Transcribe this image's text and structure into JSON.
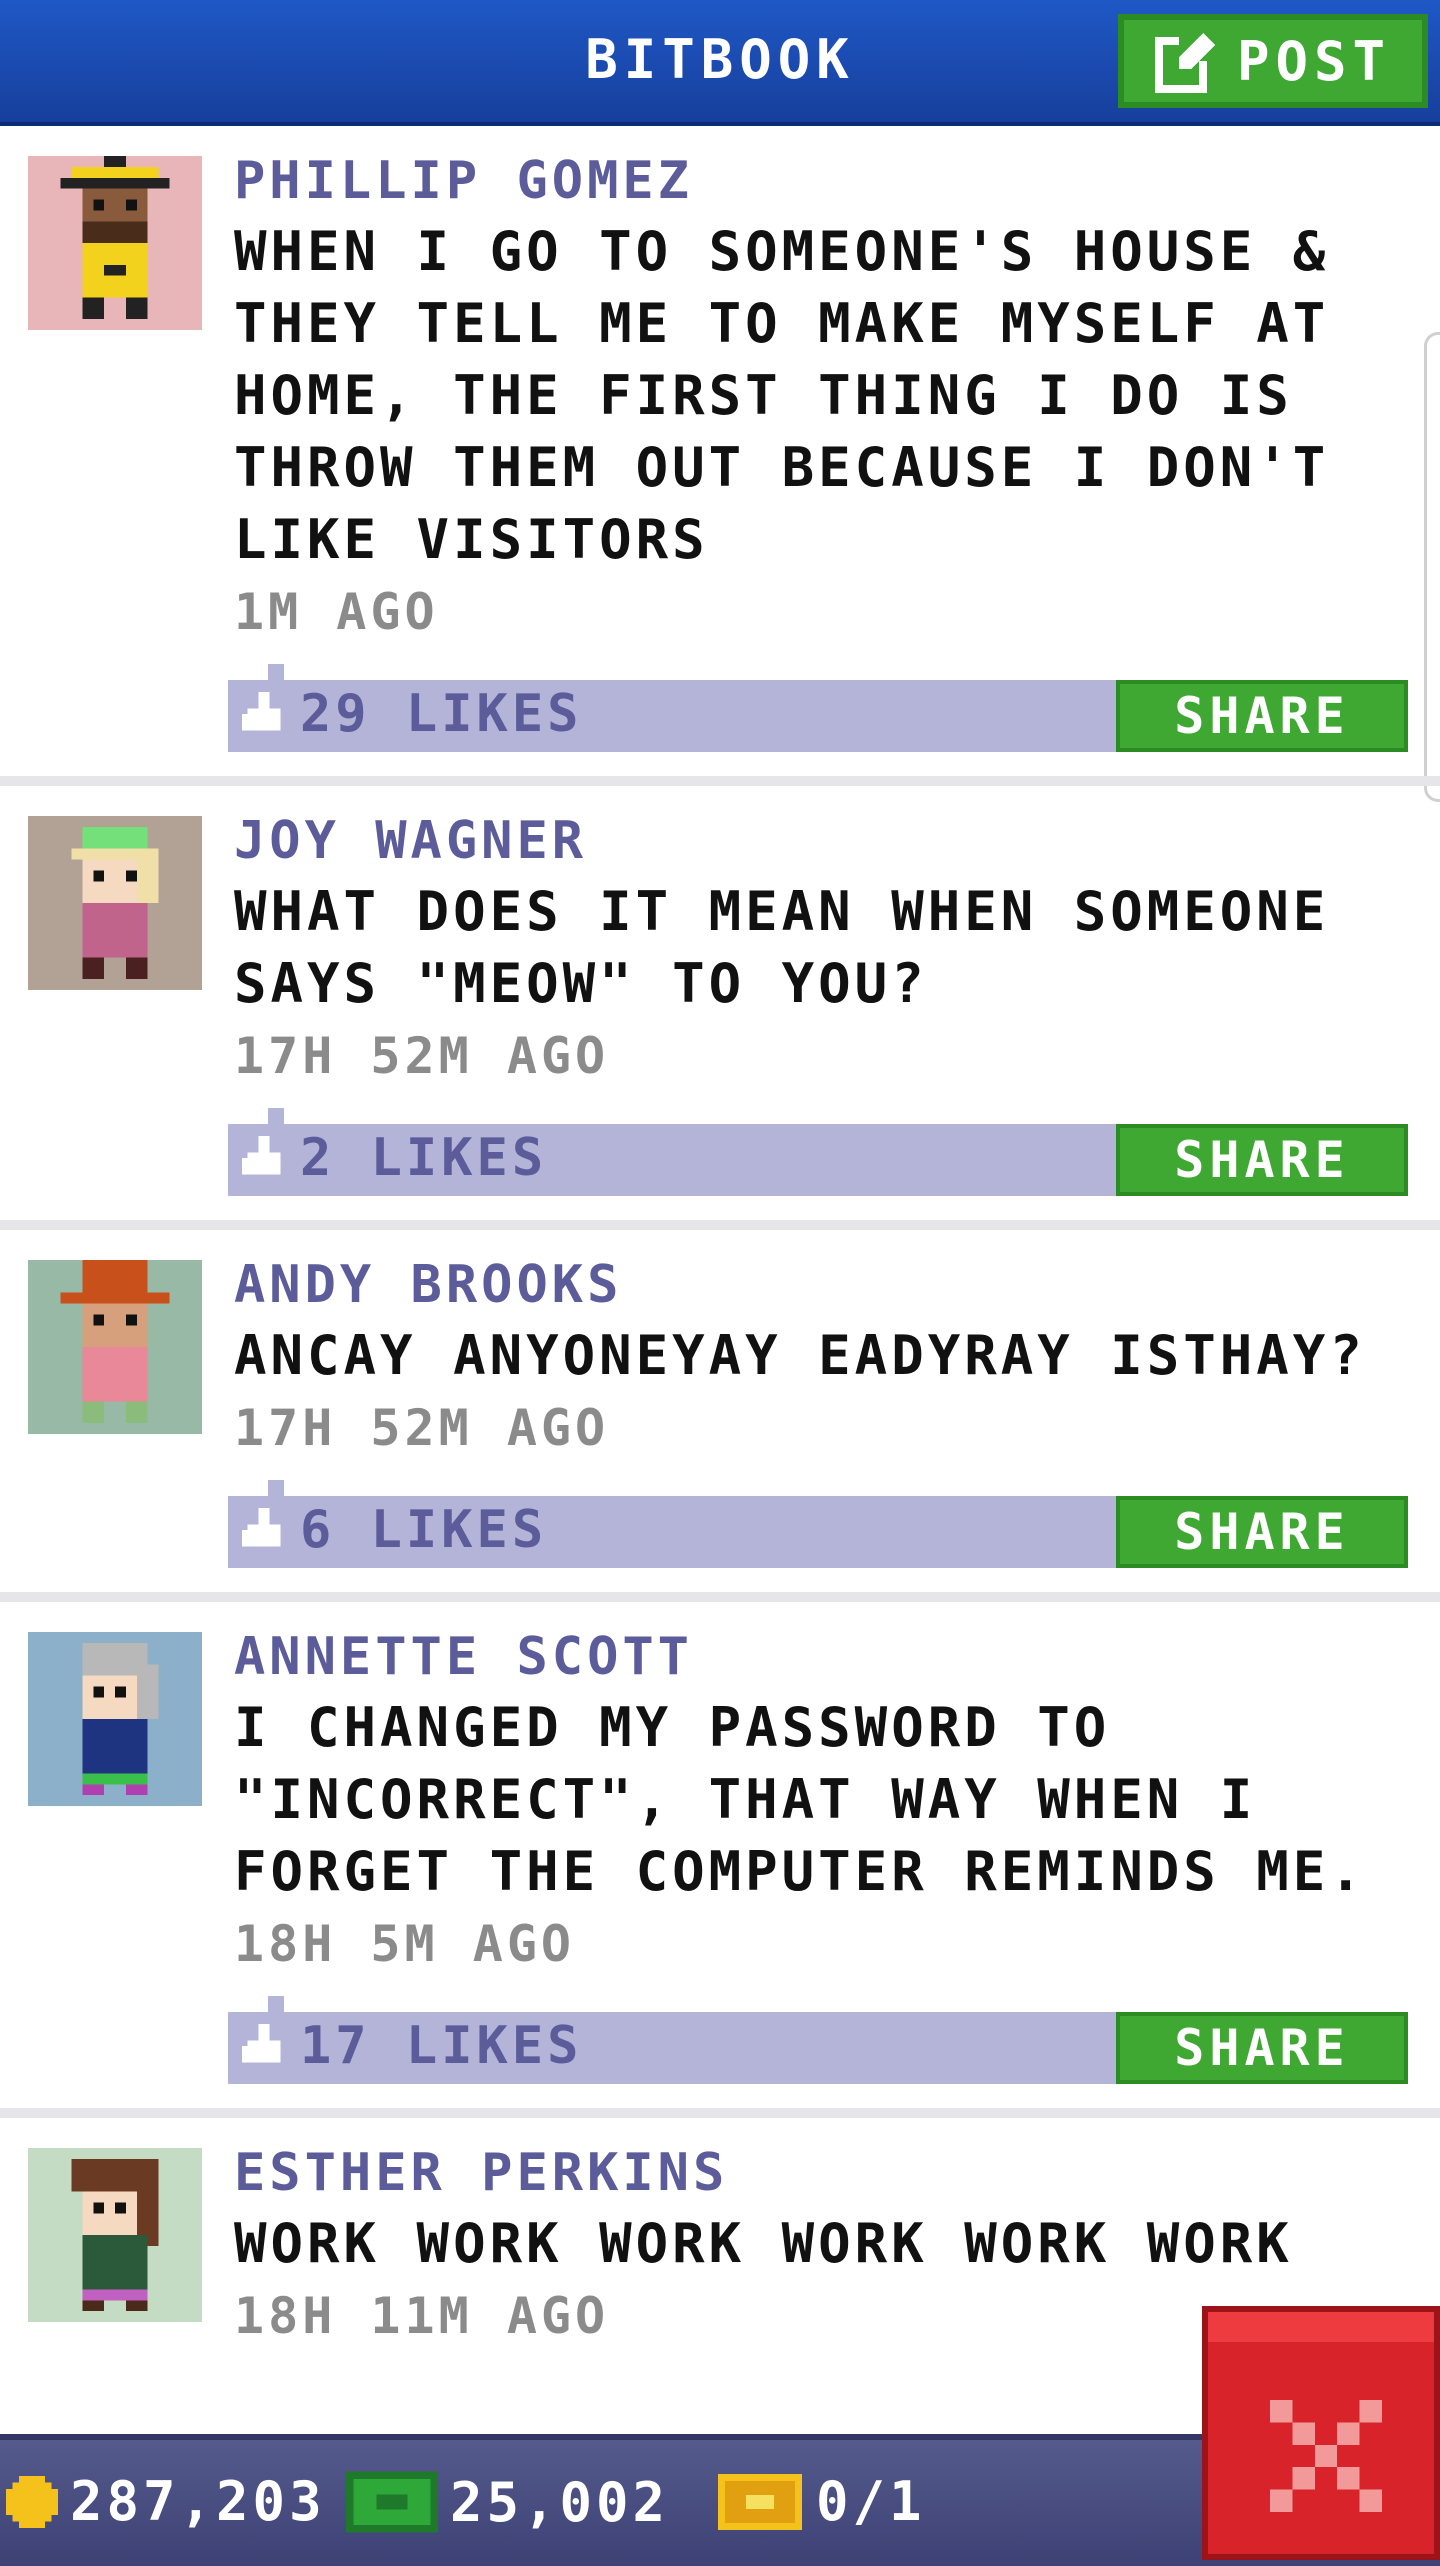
{
  "header": {
    "title": "BITBOOK",
    "post_label": "POST",
    "post_icon": "edit-icon"
  },
  "posts": [
    {
      "name": "PHILLIP GOMEZ",
      "message": " WHEN I GO TO SOMEONE'S HOUSE & THEY TELL ME TO MAKE MYSELF AT HOME, THE FIRST THING I DO IS THROW THEM OUT BECAUSE I DON'T LIKE VISITORS",
      "time": "1M AGO",
      "likes": "29 LIKES",
      "share_label": "SHARE",
      "avatar_bg": "#e8b5b8"
    },
    {
      "name": "JOY WAGNER",
      "message": "WHAT DOES IT MEAN WHEN SOMEONE SAYS \"MEOW\" TO YOU?",
      "time": "17H 52M AGO",
      "likes": "2 LIKES",
      "share_label": "SHARE",
      "avatar_bg": "#b2a296"
    },
    {
      "name": "ANDY BROOKS",
      "message": "ANCAY ANYONEYAY EADYRAY ISTHAY?",
      "time": "17H 52M AGO",
      "likes": "6 LIKES",
      "share_label": "SHARE",
      "avatar_bg": "#98b9a5"
    },
    {
      "name": "ANNETTE SCOTT",
      "message": "I CHANGED MY PASSWORD TO \"INCORRECT\", THAT WAY WHEN I FORGET THE COMPUTER REMINDS ME.",
      "time": "18H 5M AGO",
      "likes": "17 LIKES",
      "share_label": "SHARE",
      "avatar_bg": "#8cb0c9"
    },
    {
      "name": "ESTHER PERKINS",
      "message": "WORK WORK WORK WORK WORK WORK",
      "time": "18H 11M AGO",
      "avatar_bg": "#c4dcc4"
    }
  ],
  "status": {
    "coins": "287,203",
    "bux": "25,002",
    "tickets": "0/1"
  },
  "colors": {
    "accent_green": "#3fa832",
    "header_blue": "#1f58c6",
    "like_bar": "#b3b4d7",
    "name_purple": "#5b5c99",
    "close_red": "#d8232a"
  }
}
